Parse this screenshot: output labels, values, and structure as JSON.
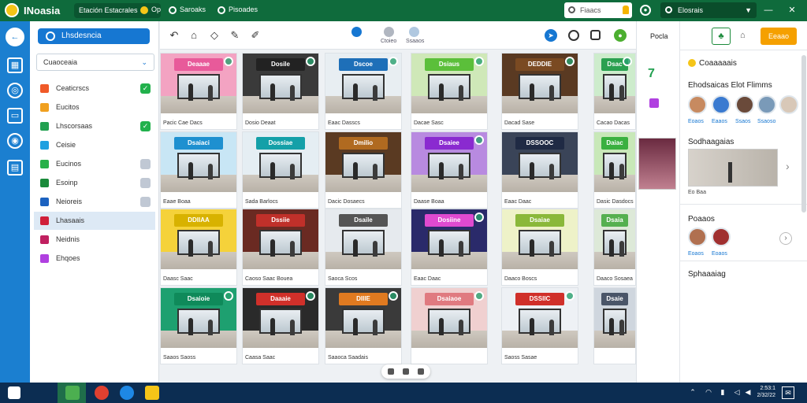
{
  "app": {
    "name": "INoasia"
  },
  "topbar": {
    "pill_label": "Etación Estacrales",
    "pill_suffix": "Op",
    "link1": "Saroaks",
    "link2": "Pisoades",
    "search_placeholder": "Fiaacs",
    "select_value": "Elosrais"
  },
  "sidebar": {
    "header": "Lhsdesncia",
    "select_value": "Cuaoceaia",
    "items": [
      {
        "label": "Ceaticrscs",
        "color": "#f05a28",
        "check_color": "#22b14c",
        "checked": true
      },
      {
        "label": "Eucitos",
        "color": "#f0a020",
        "check_color": "",
        "checked": false
      },
      {
        "label": "Lhscorsaas",
        "color": "#22a050",
        "check_color": "#22b14c",
        "checked": true
      },
      {
        "label": "Ceisie",
        "color": "#1fa0e0",
        "check_color": "",
        "checked": false
      },
      {
        "label": "Eucinos",
        "color": "#28b04a",
        "check_color": "#c0c8d4",
        "checked": true
      },
      {
        "label": "Esoinp",
        "color": "#1a8a3a",
        "check_color": "#c0c8d4",
        "checked": true
      },
      {
        "label": "Neioreis",
        "color": "#1c62c0",
        "check_color": "#c0c8d4",
        "checked": true
      },
      {
        "label": "Lhasaais",
        "color": "#d0203a",
        "check_color": "",
        "checked": false
      },
      {
        "label": "Neidnis",
        "color": "#c02060",
        "check_color": "",
        "checked": false
      },
      {
        "label": "Ehqoes",
        "color": "#b040e0",
        "check_color": "",
        "checked": false
      }
    ]
  },
  "toolbar": {
    "center_labels": [
      "",
      "Ctoieo",
      "Ssaaos"
    ]
  },
  "grid": {
    "cards": [
      {
        "sign": "Deaaae",
        "sign_color": "#e85a9a",
        "wall": "#f3a3c2",
        "caption": "Pacic Cae Dacs"
      },
      {
        "sign": "Dosile",
        "sign_color": "#222222",
        "wall": "#3a3a3a",
        "caption": "Dosio Deaat"
      },
      {
        "sign": "Dscoe",
        "sign_color": "#1e6fb8",
        "wall": "#e8eef2",
        "caption": "Eaac Dasscs"
      },
      {
        "sign": "Dsiaus",
        "sign_color": "#5bbf3a",
        "wall": "#cfe8b8",
        "caption": "Dacae Sasc"
      },
      {
        "sign": "DEDDIE",
        "sign_color": "#7a4a22",
        "wall": "#5a3a22",
        "caption": "Dacad Sase"
      },
      {
        "sign": "Dsac",
        "sign_color": "#2aa050",
        "wall": "#cdeccc",
        "caption": "Cacao Dacas"
      },
      {
        "sign": "Dsaiaci",
        "sign_color": "#1e90d0",
        "wall": "#c8e6f5",
        "caption": "Eaae Boaa"
      },
      {
        "sign": "Dossiae",
        "sign_color": "#14a0a8",
        "wall": "#e5eef3",
        "caption": "Sada Barlocs"
      },
      {
        "sign": "Dmilio",
        "sign_color": "#b06a20",
        "wall": "#5a3a22",
        "caption": "Dacic Dosaecs"
      },
      {
        "sign": "Dsaiee",
        "sign_color": "#8a2ad0",
        "wall": "#b88ae0",
        "caption": "Daase Boaa"
      },
      {
        "sign": "DSSOOC",
        "sign_color": "#1f2a44",
        "wall": "#3a4458",
        "caption": "Eaac Daac"
      },
      {
        "sign": "Daiac",
        "sign_color": "#3ab040",
        "wall": "#c8e8b8",
        "caption": "Dasic Dasdocs"
      },
      {
        "sign": "DDIIAA",
        "sign_color": "#d8b200",
        "wall": "#f5d23a",
        "caption": "Daasc Saac"
      },
      {
        "sign": "Dssiie",
        "sign_color": "#c0302a",
        "wall": "#6a2a22",
        "caption": "Caoso Saac Bouea"
      },
      {
        "sign": "Dsaile",
        "sign_color": "#555555",
        "wall": "#e6eaee",
        "caption": "Saoca Scos"
      },
      {
        "sign": "Dosiine",
        "sign_color": "#e04ad0",
        "wall": "#2a2a6a",
        "caption": "Eaac Daac"
      },
      {
        "sign": "Dsaiae",
        "sign_color": "#8ab83a",
        "wall": "#eef2c8",
        "caption": "Daaco Boscs"
      },
      {
        "sign": "Dsaia",
        "sign_color": "#55b050",
        "wall": "#dde9d8",
        "caption": "Daaco Sosaea"
      },
      {
        "sign": "Dsaioie",
        "sign_color": "#0f8a5a",
        "wall": "#1ea070",
        "caption": "Saaos Saoss"
      },
      {
        "sign": "Daaaie",
        "sign_color": "#d0302a",
        "wall": "#2a2a2a",
        "caption": "Caasa Saac"
      },
      {
        "sign": "DIIIE",
        "sign_color": "#e07a20",
        "wall": "#3a3a3a",
        "caption": "Saaoca Saadais"
      },
      {
        "sign": "Dsaiaoe",
        "sign_color": "#e07a80",
        "wall": "#f0d0d0",
        "caption": ""
      },
      {
        "sign": "DSSIIC",
        "sign_color": "#d0302a",
        "wall": "#eef1f5",
        "caption": "Saoss Sasae"
      },
      {
        "sign": "Dsaie",
        "sign_color": "#4a5568",
        "wall": "#cfd6de",
        "caption": ""
      }
    ]
  },
  "rightpanel": {
    "top_label": "Pocla",
    "action_button": "Eeaao",
    "section1_title": "Coaaaaais",
    "section2_title": "Ehodsaicas Elot Flimms",
    "thumb_labels": [
      "Eoaos",
      "Eaaos",
      "Ssaos",
      "Ssaoso"
    ],
    "section3_title": "Sodhaagaias",
    "photo_caption": "Eo Baa",
    "section4_title": "Poaaos",
    "pair_labels": [
      "Eoaos",
      "Eoaos"
    ],
    "section5_title": "Sphaaaiag"
  },
  "taskbar": {
    "time": "2:53:1",
    "date": "2/32/22"
  }
}
